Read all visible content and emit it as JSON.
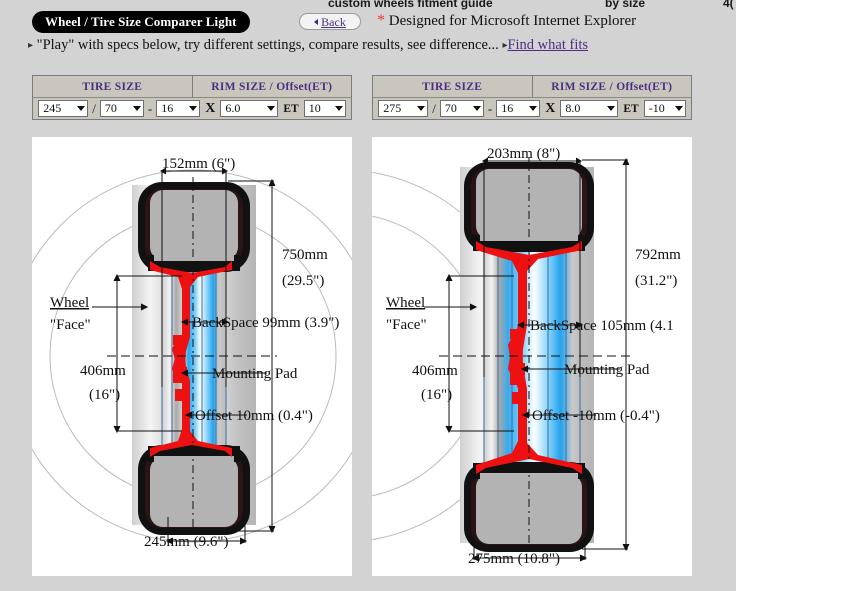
{
  "page": {
    "clipped_header": {
      "item1": "custom wheels fitment guide",
      "item2": "by size",
      "item3": "4("
    },
    "title_pill": "Wheel / Tire Size Comparer Light",
    "back_button": "Back",
    "ie_note_asterisk": "*",
    "ie_note": "Designed for Microsoft Internet Explorer",
    "play_arrow": "▸",
    "play_text": "\"Play\" with specs below, try different settings, compare results, see difference...",
    "find_arrow": "▸",
    "find_link": "Find what fits"
  },
  "spec_headers": {
    "tire": "TIRE SIZE",
    "rim": "RIM SIZE / Offset(ET)"
  },
  "glyphs": {
    "slash": "/",
    "dash": "-",
    "x": "X",
    "et": "ET"
  },
  "spec_left": {
    "width": "245",
    "aspect": "70",
    "diameter": "16",
    "rim_width": "6.0",
    "offset": "10"
  },
  "spec_right": {
    "width": "275",
    "aspect": "70",
    "diameter": "16",
    "rim_width": "8.0",
    "offset": "-10"
  },
  "diagram_left": {
    "rim_width_label": "152mm (6\")",
    "overall_diameter_line1": "750mm",
    "overall_diameter_line2": "(29.5\")",
    "wheel_face_line1": "Wheel",
    "wheel_face_line2": "\"Face\"",
    "backspace_label": "BackSpace 99mm (3.9\")",
    "rim_diameter_line1": "406mm",
    "rim_diameter_line2": "(16\")",
    "mounting_pad_label": "Mounting Pad",
    "offset_label": "Offset 10mm (0.4\")",
    "tire_width_label": "245mm (9.6\")"
  },
  "diagram_right": {
    "rim_width_label": "203mm (8\")",
    "overall_diameter_line1": "792mm",
    "overall_diameter_line2": "(31.2\")",
    "wheel_face_line1": "Wheel",
    "wheel_face_line2": "\"Face\"",
    "backspace_label": "BackSpace 105mm (4.1",
    "rim_diameter_line1": "406mm",
    "rim_diameter_line2": "(16\")",
    "mounting_pad_label": "Mounting Pad",
    "offset_label": "Offset -10mm (-0.4\")",
    "tire_width_label": "275mm (10.8\")"
  },
  "colors": {
    "page_bg": "#d3d3d3",
    "panel_bg": "#ffffff",
    "accent_purple": "#4b2e83",
    "asterisk_red": "#e23b2e",
    "rim_red": "#ee1111",
    "tire_black": "#111111",
    "tire_gray": "#b3b3b3",
    "cyl_blue": "#1ba1ee",
    "table_bg": "#c8c6bd"
  }
}
